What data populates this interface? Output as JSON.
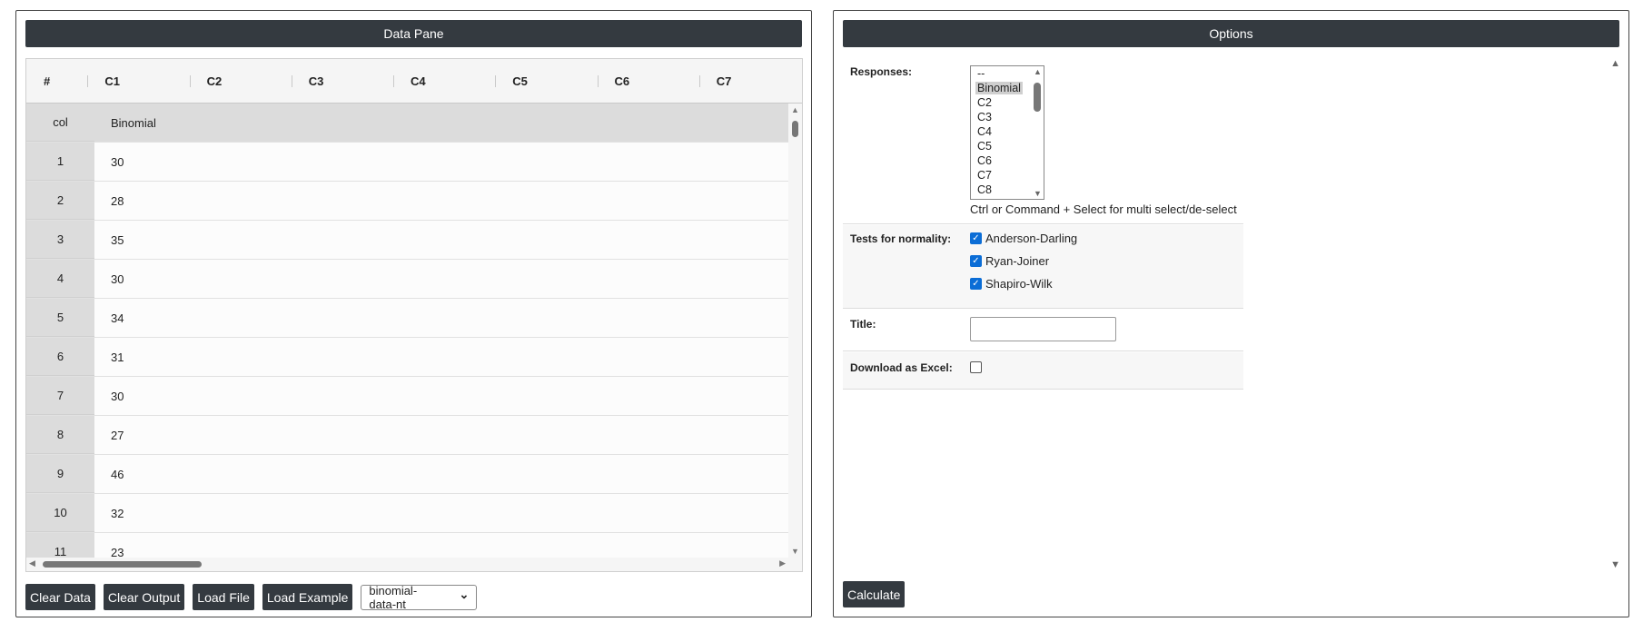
{
  "data_pane": {
    "title": "Data Pane",
    "columns": [
      "#",
      "C1",
      "C2",
      "C3",
      "C4",
      "C5",
      "C6",
      "C7"
    ],
    "rows": [
      {
        "idx": "col",
        "value": "Binomial"
      },
      {
        "idx": "1",
        "value": "30"
      },
      {
        "idx": "2",
        "value": "28"
      },
      {
        "idx": "3",
        "value": "35"
      },
      {
        "idx": "4",
        "value": "30"
      },
      {
        "idx": "5",
        "value": "34"
      },
      {
        "idx": "6",
        "value": "31"
      },
      {
        "idx": "7",
        "value": "30"
      },
      {
        "idx": "8",
        "value": "27"
      },
      {
        "idx": "9",
        "value": "46"
      },
      {
        "idx": "10",
        "value": "32"
      },
      {
        "idx": "11",
        "value": "23"
      }
    ],
    "buttons": {
      "clear_data": "Clear Data",
      "clear_output": "Clear Output",
      "load_file": "Load File",
      "load_example": "Load Example"
    },
    "example_select": {
      "value": "binomial-data-nt"
    }
  },
  "options": {
    "title": "Options",
    "responses": {
      "label": "Responses:",
      "items": [
        "--",
        "Binomial",
        "C2",
        "C3",
        "C4",
        "C5",
        "C6",
        "C7",
        "C8"
      ],
      "selected": "Binomial",
      "help": "Ctrl or Command + Select for multi select/de-select"
    },
    "normality": {
      "label": "Tests for normality:",
      "tests": [
        {
          "label": "Anderson-Darling",
          "checked": true
        },
        {
          "label": "Ryan-Joiner",
          "checked": true
        },
        {
          "label": "Shapiro-Wilk",
          "checked": true
        }
      ]
    },
    "title_field": {
      "label": "Title:",
      "value": ""
    },
    "download_excel": {
      "label": "Download as Excel:",
      "checked": false
    },
    "calculate": "Calculate"
  },
  "icons": {
    "checkmark": "✓",
    "arrow_up": "▲",
    "arrow_down": "▼",
    "arrow_left": "◀",
    "arrow_right": "▶",
    "select_chevron": "⌄"
  }
}
